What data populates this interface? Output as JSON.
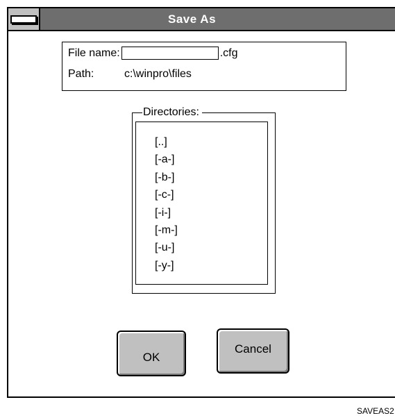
{
  "dialog": {
    "title": "Save As"
  },
  "file": {
    "label": "File name:",
    "value": "",
    "extension": ".cfg"
  },
  "path": {
    "label": "Path:",
    "value": "c:\\winpro\\files"
  },
  "directories": {
    "label": "Directories:",
    "items": [
      "[..]",
      "[-a-]",
      "[-b-]",
      "[-c-]",
      "[-i-]",
      "[-m-]",
      "[-u-]",
      "[-y-]"
    ]
  },
  "buttons": {
    "ok": "OK",
    "cancel": "Cancel"
  },
  "figure_caption": "SAVEAS2"
}
